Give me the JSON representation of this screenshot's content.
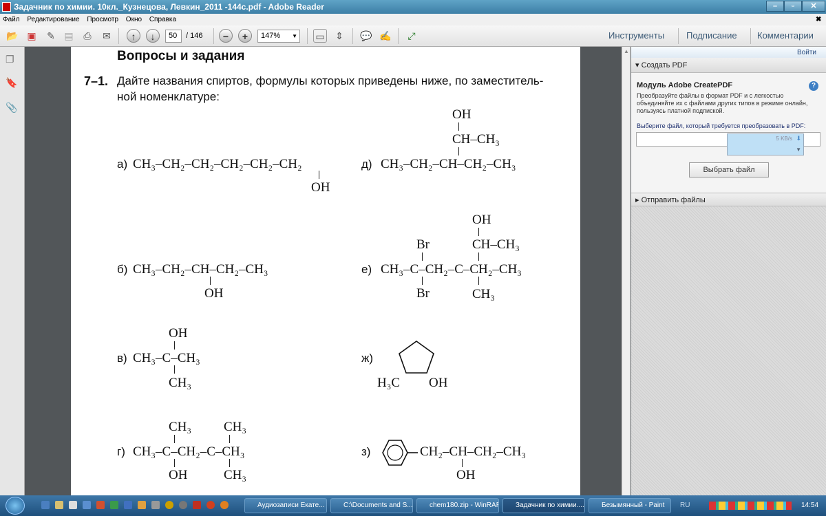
{
  "window": {
    "title": "Задачник по химии. 10кл._Кузнецова, Левкин_2011 -144с.pdf - Adobe Reader"
  },
  "menu": [
    "Файл",
    "Редактирование",
    "Просмотр",
    "Окно",
    "Справка"
  ],
  "toolbar": {
    "page": "50",
    "total": "/ 146",
    "zoom": "147%"
  },
  "right_tabs": [
    "Инструменты",
    "Подписание",
    "Комментарии"
  ],
  "panel": {
    "login": "Войти",
    "create_pdf": "Создать PDF",
    "module_title": "Модуль Adobe CreatePDF",
    "description": "Преобразуйте файлы в формат PDF и с легкостью объединяйте их с файлами других типов в режиме онлайн, пользуясь платной подпиской.",
    "select_prompt": "Выберите файл, который требуется преобразовать в PDF:",
    "speed": "5 KB/s",
    "choose_button": "Выбрать файл",
    "send_files": "Отправить файлы"
  },
  "doc": {
    "heading": "Вопросы и задания",
    "task_num": "7–1.",
    "task_line1": "Дайте названия спиртов, формулы которых приведены ниже, по заместитель-",
    "task_line2": "ной номенклатуре:",
    "a": {
      "label": "а)",
      "main": "CH₃–CH₂–CH₂–CH₂–CH₂–CH₂",
      "below": "OH"
    },
    "d": {
      "label": "д)",
      "main": "CH₃–CH₂–CH–CH₂–CH₃",
      "above1": "OH",
      "above2": "CH–CH₃"
    },
    "b": {
      "label": "б)",
      "main": "CH₃–CH₂–CH–CH₂–CH₃",
      "below": "OH"
    },
    "e": {
      "label": "е)",
      "main": "CH₃–C–CH₂–C–CH₂–CH₃",
      "br_top": "Br",
      "br_bottom": "Br",
      "oh": "OH",
      "ch": "CH–CH₃",
      "ch3": "CH₃"
    },
    "v": {
      "label": "в)",
      "main": "CH₃–C–CH₃",
      "above": "OH",
      "below": "CH₃"
    },
    "zh": {
      "label": "ж)",
      "left": "H₃C",
      "right": "OH"
    },
    "g": {
      "label": "г)",
      "main": "CH₃–C–CH₂–C–CH₃",
      "above1": "CH₃",
      "above2": "CH₃",
      "below1": "OH",
      "below2": "CH₃"
    },
    "z": {
      "label": "з)",
      "main": "CH₂–CH–CH₂–CH₃",
      "below": "OH"
    }
  },
  "taskbar": {
    "tasks": [
      "Аудиозаписи Екате...",
      "C:\\Documents and S...",
      "chem180.zip - WinRAR",
      "Задачник по химии....",
      "Безымянный - Paint"
    ],
    "lang": "RU",
    "time": "14:54"
  }
}
